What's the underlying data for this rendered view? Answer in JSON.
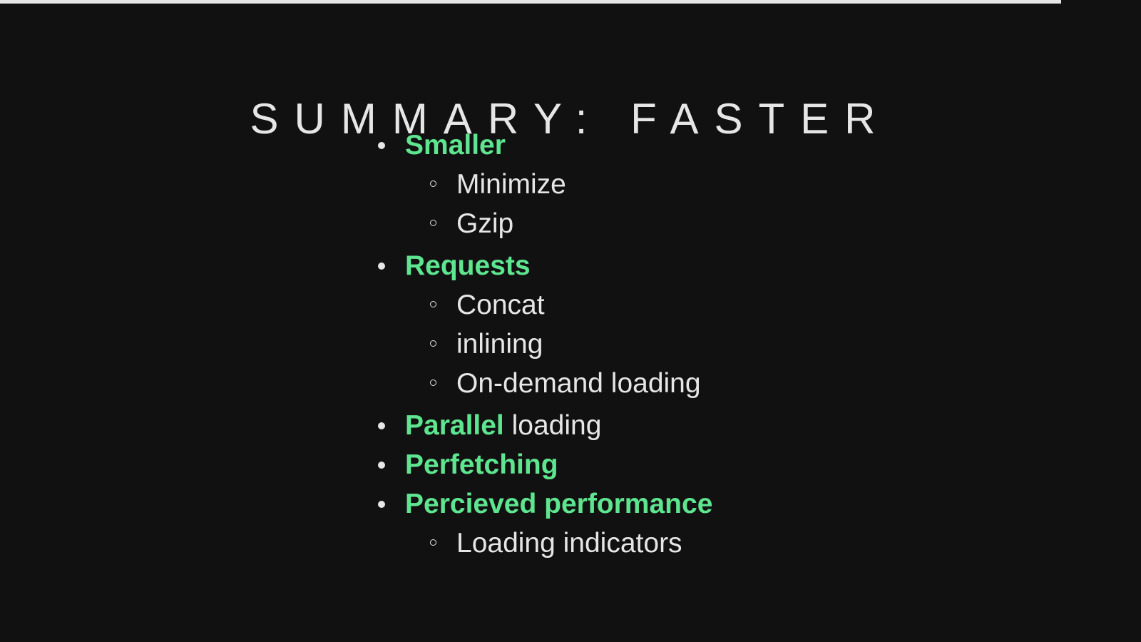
{
  "progress": {
    "fraction": 0.93
  },
  "slide": {
    "title": "Summary: Faster",
    "items": [
      {
        "strong": "Smaller",
        "rest": "",
        "subitems": [
          "Minimize",
          "Gzip"
        ]
      },
      {
        "strong": "Requests",
        "rest": "",
        "subitems": [
          "Concat",
          "inlining",
          "On-demand loading"
        ]
      },
      {
        "strong": "Parallel",
        "rest": " loading",
        "subitems": []
      },
      {
        "strong": "Perfetching",
        "rest": "",
        "subitems": []
      },
      {
        "strong": "Percieved performance",
        "rest": "",
        "subitems": [
          "Loading indicators"
        ]
      }
    ]
  },
  "colors": {
    "background": "#111111",
    "text": "#e6e6e6",
    "accent": "#5ee58f"
  }
}
